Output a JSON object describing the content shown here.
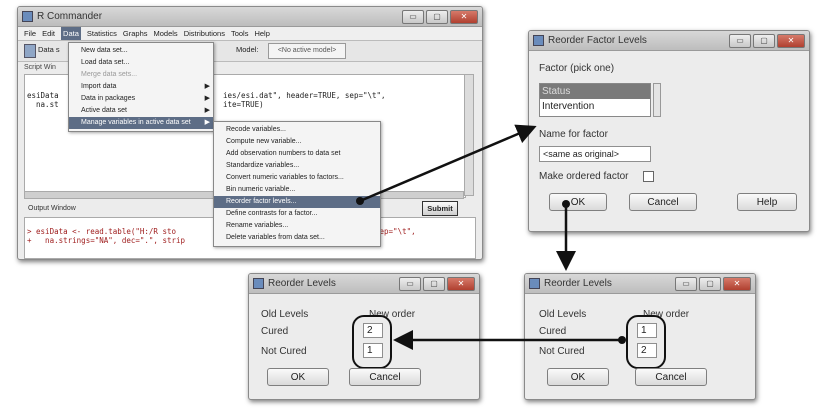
{
  "rcmdr": {
    "title": "R Commander",
    "menubar": [
      "File",
      "Edit",
      "Data",
      "Statistics",
      "Graphs",
      "Models",
      "Distributions",
      "Tools",
      "Help"
    ],
    "toolbar": {
      "dataset_label": "Data s",
      "model_label": "Model:",
      "model_value": "<No active model>"
    },
    "script_tab": "Script Win",
    "script_lines": [
      "esiData",
      "  na.st"
    ],
    "script_right": [
      "ies/esi.dat\", header=TRUE, sep=\"\\t\",",
      "ite=TRUE)"
    ],
    "output_label": "Output Window",
    "submit_label": "Submit",
    "output_lines": [
      "> esiData <- read.table(\"H:/R sto",
      "+   na.strings=\"NA\", dec=\".\", strip"
    ],
    "output_right": "sep=\"\\t\","
  },
  "data_menu": {
    "items": [
      {
        "label": "New data set...",
        "state": "normal"
      },
      {
        "label": "Load data set...",
        "state": "normal"
      },
      {
        "label": "Merge data sets...",
        "state": "disabled"
      },
      {
        "label": "Import data",
        "state": "normal",
        "submenu": true
      },
      {
        "label": "Data in packages",
        "state": "normal",
        "submenu": true
      },
      {
        "label": "Active data set",
        "state": "normal",
        "submenu": true
      },
      {
        "label": "Manage variables in active data set",
        "state": "highlighted",
        "submenu": true
      }
    ]
  },
  "sub_menu": {
    "items": [
      {
        "label": "Recode variables...",
        "state": "normal"
      },
      {
        "label": "Compute new variable...",
        "state": "normal"
      },
      {
        "label": "Add observation numbers to data set",
        "state": "normal"
      },
      {
        "label": "Standardize variables...",
        "state": "normal"
      },
      {
        "label": "Convert numeric variables to factors...",
        "state": "normal"
      },
      {
        "label": "Bin numeric variable...",
        "state": "normal"
      },
      {
        "label": "Reorder factor levels...",
        "state": "highlighted"
      },
      {
        "label": "Define contrasts for a factor...",
        "state": "normal"
      },
      {
        "label": "Rename variables...",
        "state": "normal"
      },
      {
        "label": "Delete variables from data set...",
        "state": "normal"
      }
    ]
  },
  "reorder_factor": {
    "title": "Reorder Factor Levels",
    "factor_label": "Factor (pick one)",
    "factors": [
      {
        "label": "Status",
        "selected": true
      },
      {
        "label": "Intervention",
        "selected": false
      }
    ],
    "name_label": "Name for factor",
    "name_value": "<same as original>",
    "ordered_label": "Make ordered factor",
    "ok": "OK",
    "cancel": "Cancel",
    "help": "Help"
  },
  "reorder_levels_left": {
    "title": "Reorder Levels",
    "col_old": "Old Levels",
    "col_new": "New order",
    "rows": [
      {
        "level": "Cured",
        "order": "2"
      },
      {
        "level": "Not Cured",
        "order": "1"
      }
    ],
    "ok": "OK",
    "cancel": "Cancel"
  },
  "reorder_levels_right": {
    "title": "Reorder Levels",
    "col_old": "Old Levels",
    "col_new": "New order",
    "rows": [
      {
        "level": "Cured",
        "order": "1"
      },
      {
        "level": "Not Cured",
        "order": "2"
      }
    ],
    "ok": "OK",
    "cancel": "Cancel"
  },
  "window_buttons": {
    "minimize": "▭",
    "maximize": "▢",
    "close": "✕"
  },
  "colors": {
    "menu_highlight": "#5d6d86",
    "list_selection": "#7a7a7a",
    "annotation": "#111111"
  }
}
